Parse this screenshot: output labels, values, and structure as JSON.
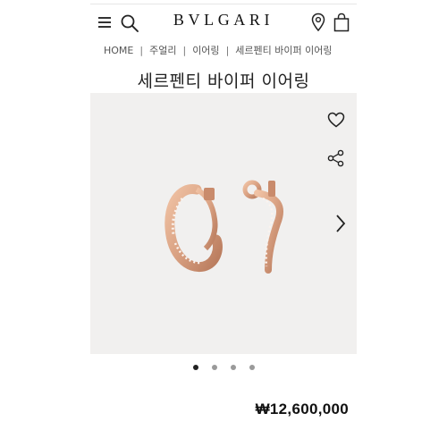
{
  "header": {
    "brand": "BVLGARI",
    "icons": [
      "menu-icon",
      "search-icon",
      "store-locator-icon",
      "shopping-bag-icon"
    ]
  },
  "breadcrumb": {
    "items": [
      "HOME",
      "주얼리",
      "이어링",
      "세르펜티 바이퍼 이어링"
    ]
  },
  "product": {
    "title": "세르펜티 바이퍼 이어링",
    "price": "₩12,600,000",
    "gallery": {
      "current_slide": 1,
      "total_slides": 4
    }
  },
  "colors": {
    "image_background": "#f1f0ef",
    "rose_gold": "#d9a182"
  }
}
